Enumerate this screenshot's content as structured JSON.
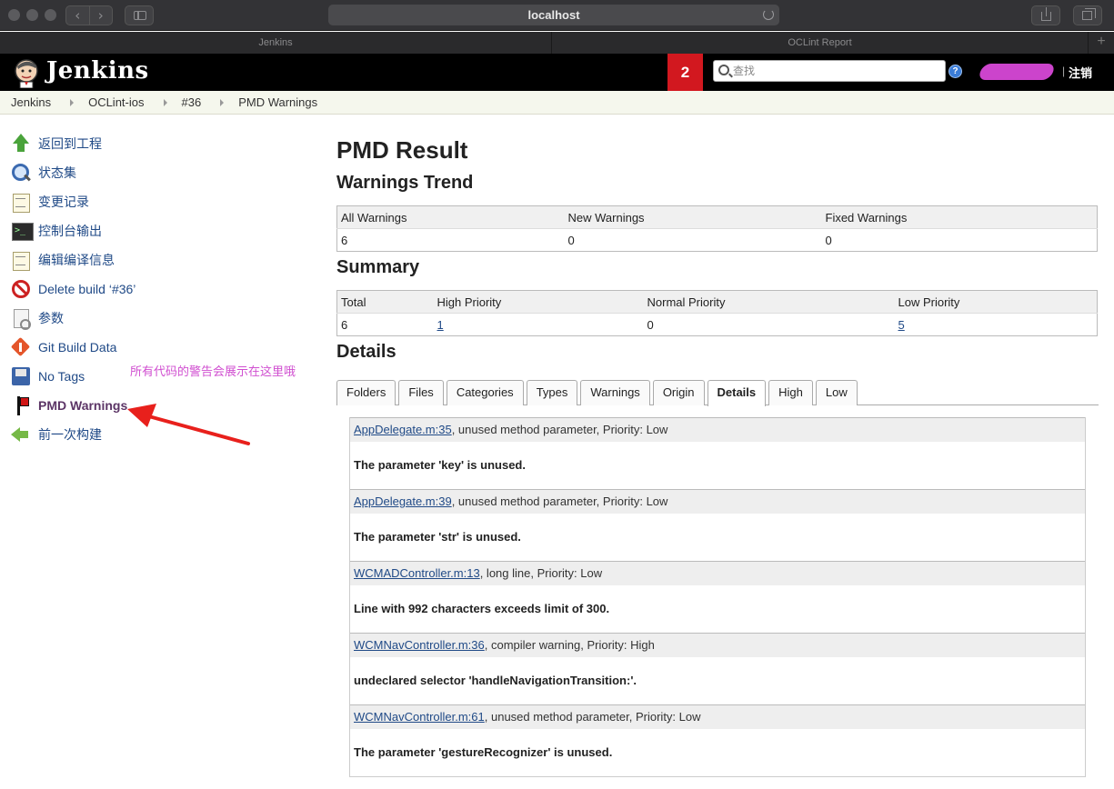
{
  "browser": {
    "url": "localhost",
    "tabs": [
      "Jenkins",
      "OCLint Report"
    ]
  },
  "header": {
    "title": "Jenkins",
    "notification_count": "2",
    "search_placeholder": "查找",
    "help_label": "?",
    "logout_label": "注销",
    "colors": {
      "bar": "#000000",
      "badge": "#d2181f",
      "user_scribble": "#cc44cc"
    }
  },
  "breadcrumb": [
    "Jenkins",
    "OCLint-ios",
    "#36",
    "PMD Warnings"
  ],
  "sidebar": {
    "items": [
      {
        "label": "返回到工程",
        "icon": "up-arrow-icon"
      },
      {
        "label": "状态集",
        "icon": "magnifier-icon"
      },
      {
        "label": "变更记录",
        "icon": "notepad-icon"
      },
      {
        "label": "控制台输出",
        "icon": "terminal-icon"
      },
      {
        "label": "编辑编译信息",
        "icon": "notepad-icon"
      },
      {
        "label": "Delete build ‘#36’",
        "icon": "no-entry-icon"
      },
      {
        "label": "参数",
        "icon": "parameters-icon"
      },
      {
        "label": "Git Build Data",
        "icon": "git-icon"
      },
      {
        "label": "No Tags",
        "icon": "disk-icon"
      },
      {
        "label": "PMD Warnings",
        "icon": "flag-icon"
      },
      {
        "label": "前一次构建",
        "icon": "left-arrow-icon"
      }
    ],
    "annotation": "所有代码的警告会展示在这里哦"
  },
  "main": {
    "title": "PMD Result",
    "trend": {
      "heading": "Warnings Trend",
      "headers": [
        "All Warnings",
        "New Warnings",
        "Fixed Warnings"
      ],
      "values": [
        "6",
        "0",
        "0"
      ]
    },
    "summary": {
      "heading": "Summary",
      "headers": [
        "Total",
        "High Priority",
        "Normal Priority",
        "Low Priority"
      ],
      "values": [
        "6",
        "1",
        "0",
        "5"
      ]
    },
    "details": {
      "heading": "Details",
      "tabs": [
        "Folders",
        "Files",
        "Categories",
        "Types",
        "Warnings",
        "Origin",
        "Details",
        "High",
        "Low"
      ],
      "selected_tab": "Details",
      "warnings": [
        {
          "file": "AppDelegate.m:35",
          "info": ", unused method parameter, Priority: Low",
          "message": "The parameter 'key' is unused."
        },
        {
          "file": "AppDelegate.m:39",
          "info": ", unused method parameter, Priority: Low",
          "message": "The parameter 'str' is unused."
        },
        {
          "file": "WCMADController.m:13",
          "info": ", long line, Priority: Low",
          "message": "Line with 992 characters exceeds limit of 300."
        },
        {
          "file": "WCMNavController.m:36",
          "info": ", compiler warning, Priority: High",
          "message": "undeclared selector 'handleNavigationTransition:'."
        },
        {
          "file": "WCMNavController.m:61",
          "info": ", unused method parameter, Priority: Low",
          "message": "The parameter 'gestureRecognizer' is unused."
        }
      ]
    }
  }
}
